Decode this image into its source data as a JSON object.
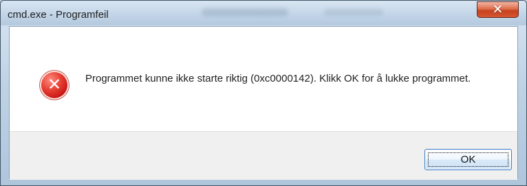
{
  "window": {
    "title": "cmd.exe - Programfeil"
  },
  "titlebar": {
    "close_icon": "close-icon",
    "close_glyph": "✕"
  },
  "dialog": {
    "icon": "error-icon",
    "icon_glyph": "✕",
    "message": "Programmet kunne ikke starte riktig (0xc0000142). Klikk OK for å lukke programmet."
  },
  "actions": {
    "ok_label": "OK"
  },
  "colors": {
    "window_frame": "#b9c9da",
    "close_button": "#c7421e",
    "error_red": "#c31212",
    "footer_bg": "#f0f0f0",
    "button_border": "#3b79c1"
  }
}
